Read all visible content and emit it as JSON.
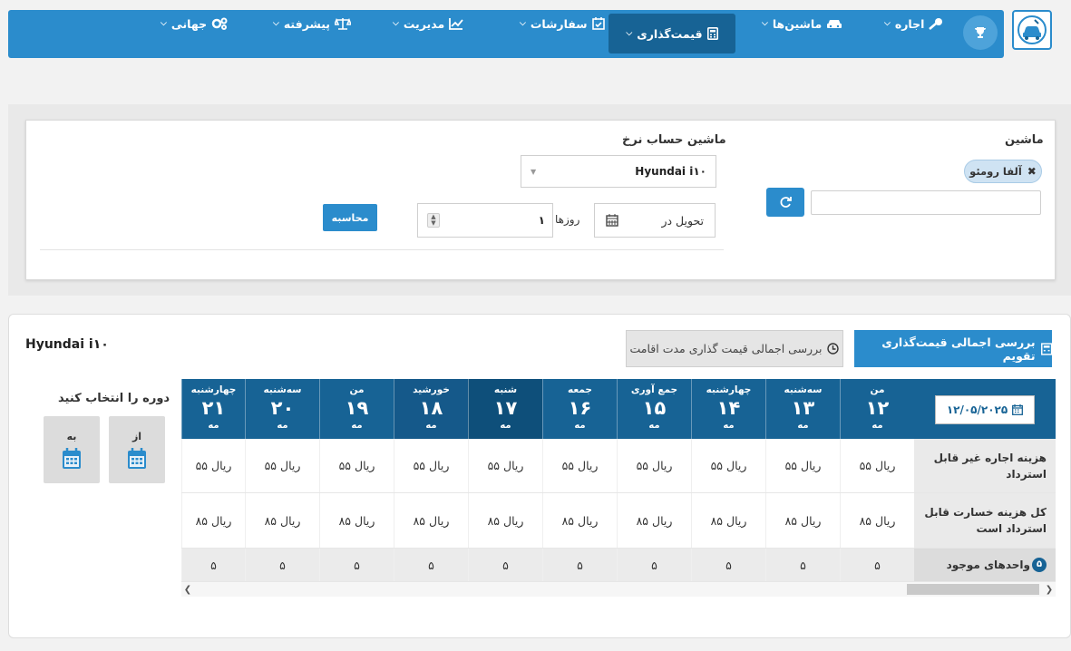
{
  "nav": {
    "items": [
      {
        "label": "جهانی",
        "icon": "cogs-icon"
      },
      {
        "label": "پیشرفته",
        "icon": "scale-icon"
      },
      {
        "label": "مدیریت",
        "icon": "chart-icon"
      },
      {
        "label": "سفارشات",
        "icon": "calendar-check-icon"
      },
      {
        "label": "قیمت‌گذاری",
        "icon": "calculator-icon",
        "active": true
      },
      {
        "label": "ماشین‌ها",
        "icon": "car-icon"
      },
      {
        "label": "اجاره",
        "icon": "key-icon"
      }
    ]
  },
  "form": {
    "car_label": "ماشین",
    "selected_tag": "آلفا رومئو",
    "calc_car_label": "ماشین حساب نرخ",
    "calc_car_value": "Hyundai i۱۰",
    "delivery_placeholder": "تحویل در",
    "days_value": "۱",
    "days_label": "روزها",
    "calc_button": "محاسبه"
  },
  "calendar": {
    "car_title": "Hyundai i۱۰",
    "overview_button": "بررسی اجمالی قیمت‌گذاری تقویم",
    "stay_button": "بررسی اجمالی قیمت گذاری مدت اقامت",
    "period_label": "دوره را انتخاب کنید",
    "from_label": "از",
    "to_label": "به",
    "date_value": "۱۲/۰۵/۲۰۲۵",
    "days": [
      {
        "name": "من",
        "num": "۱۲",
        "month": "مه"
      },
      {
        "name": "سه‌شنبه",
        "num": "۱۳",
        "month": "مه"
      },
      {
        "name": "چهارشنبه",
        "num": "۱۴",
        "month": "مه"
      },
      {
        "name": "جمع آوری",
        "num": "۱۵",
        "month": "مه"
      },
      {
        "name": "جمعه",
        "num": "۱۶",
        "month": "مه"
      },
      {
        "name": "شنبه",
        "num": "۱۷",
        "month": "مه"
      },
      {
        "name": "خورشید",
        "num": "۱۸",
        "month": "مه"
      },
      {
        "name": "من",
        "num": "۱۹",
        "month": "مه"
      },
      {
        "name": "سه‌شنبه",
        "num": "۲۰",
        "month": "مه"
      },
      {
        "name": "چهارشنبه",
        "num": "۲۱",
        "month": "مه"
      }
    ],
    "rows": [
      {
        "label": "هزینه اجاره غیر قابل استرداد",
        "value": "ریال ۵۵"
      },
      {
        "label": "کل هزینه خسارت قابل استرداد است",
        "value": "ریال ۸۵"
      },
      {
        "label": "واحدهای موجود",
        "value": "۵",
        "badge": "۵"
      }
    ]
  }
}
